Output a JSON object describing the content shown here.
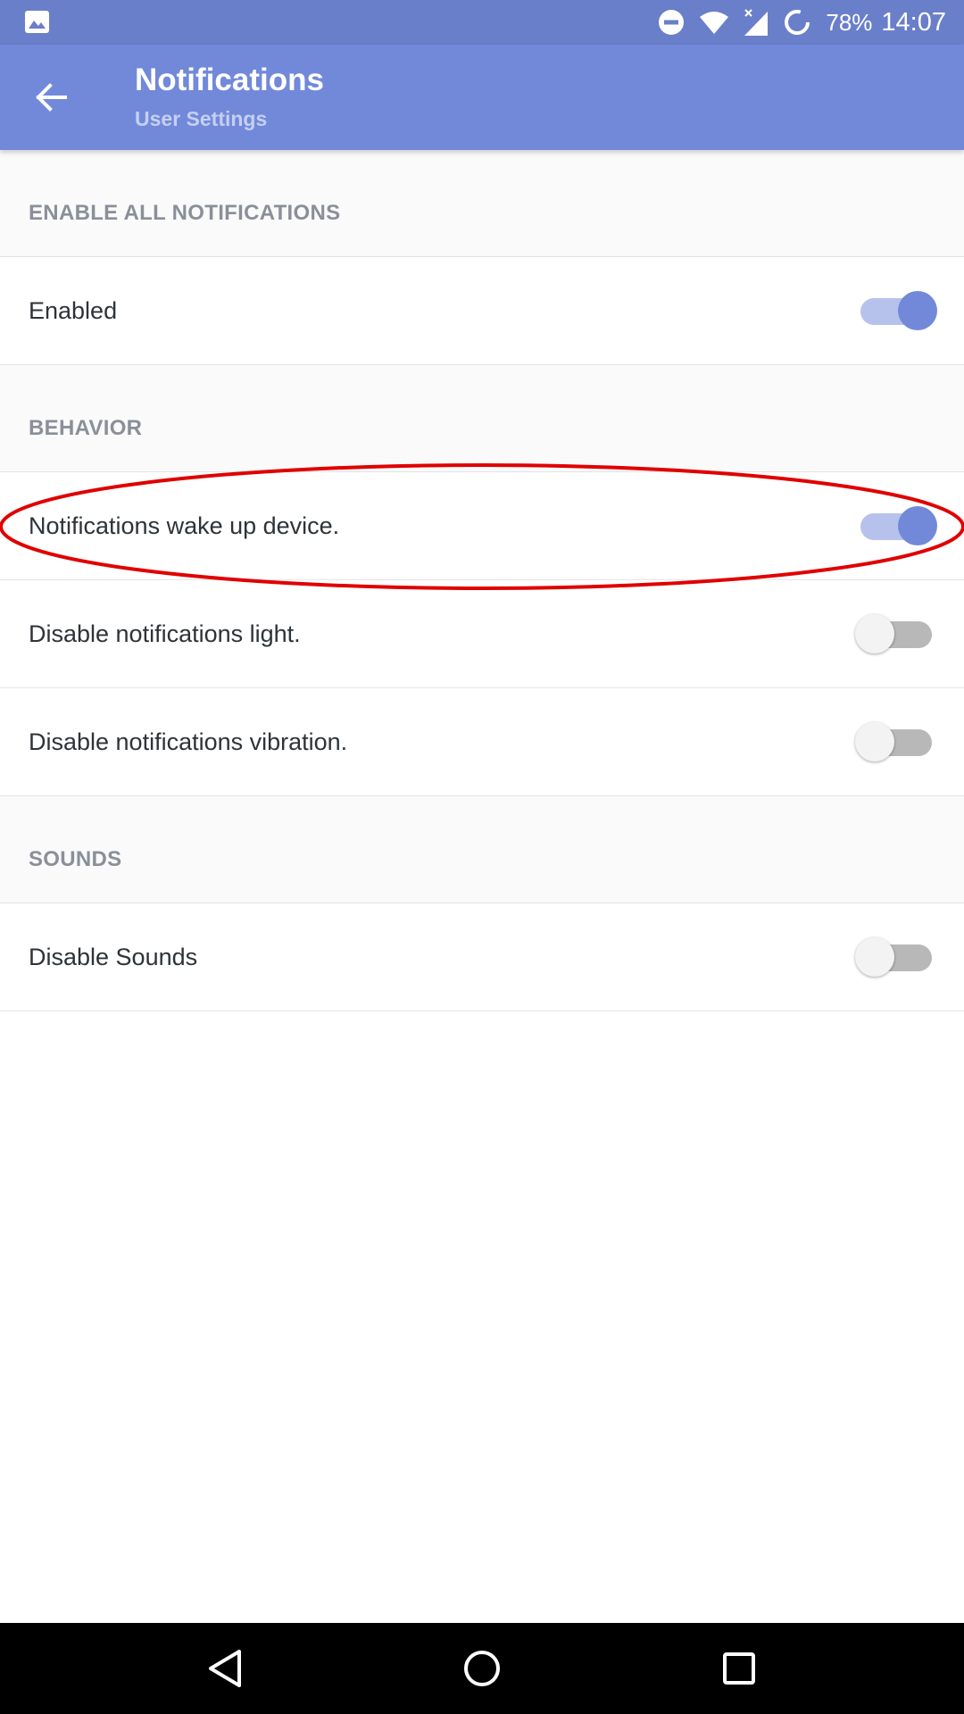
{
  "status_bar": {
    "battery": "78%",
    "time": "14:07",
    "icons": [
      "image-icon",
      "do-not-disturb-icon",
      "wifi-icon",
      "signal-icon",
      "battery-saver-icon"
    ]
  },
  "app_bar": {
    "title": "Notifications",
    "subtitle": "User Settings",
    "back_icon": "arrow-back-icon"
  },
  "sections": [
    {
      "header": "ENABLE ALL NOTIFICATIONS",
      "items": [
        {
          "label": "Enabled",
          "on": true
        }
      ]
    },
    {
      "header": "BEHAVIOR",
      "items": [
        {
          "label": "Notifications wake up device.",
          "on": true
        },
        {
          "label": "Disable notifications light.",
          "on": false
        },
        {
          "label": "Disable notifications vibration.",
          "on": false
        }
      ]
    },
    {
      "header": "SOUNDS",
      "items": [
        {
          "label": "Disable Sounds",
          "on": false
        }
      ]
    }
  ],
  "annotation": {
    "color": "#e00000",
    "target": "Notifications wake up device."
  },
  "colors": {
    "status_bar": "#6a7fc9",
    "app_bar": "#7289da",
    "toggle_on": "#7289da",
    "toggle_on_track": "#b7c2ec"
  },
  "nav_bar": {
    "icons": [
      "back-triangle-icon",
      "home-circle-icon",
      "recents-square-icon"
    ]
  }
}
